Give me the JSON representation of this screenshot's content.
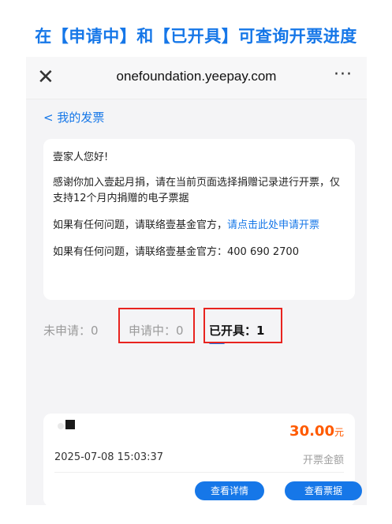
{
  "headline": {
    "prefix": "在",
    "bracket_open": "【",
    "bracket_close": "】",
    "tab1": "申请中",
    "and": "和",
    "tab2": "已开具",
    "suffix": "可查询开票进度"
  },
  "browser": {
    "close_icon": "close-icon",
    "url": "onefoundation.yeepay.com",
    "more": "···"
  },
  "nav": {
    "back_label": "< 我的发票"
  },
  "info": {
    "greeting": "壹家人您好!",
    "para1": "感谢你加入壹起月捐，请在当前页面选择捐赠记录进行开票，仅支持12个月内捐赠的电子票据",
    "para2_text": "如果有任何问题，请联络壹基金官方，",
    "para2_link": "请点击此处申请开票",
    "para3": "如果有任何问题，请联络壹基金官方：400 690 2700"
  },
  "tabs": [
    {
      "label": "未申请：0"
    },
    {
      "label": "申请中：0"
    },
    {
      "label": "已开具：1"
    }
  ],
  "record": {
    "amount": "30.00",
    "unit": "元",
    "date": "2025-07-08 15:03:37",
    "amount_label": "开票金额",
    "btn_detail": "查看详情",
    "btn_receipt": "查看票据"
  },
  "colors": {
    "accent": "#1677e8",
    "highlight": "#e8231f",
    "amount": "#ff5a00"
  }
}
